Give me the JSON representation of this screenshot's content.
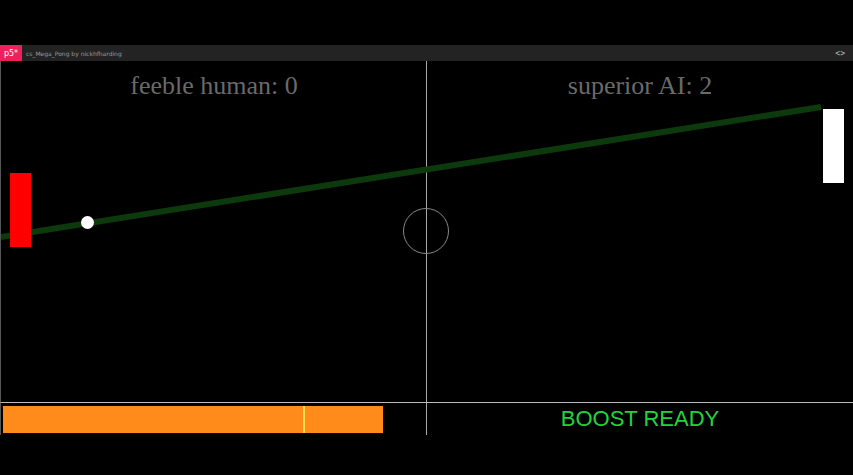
{
  "editor": {
    "logo": "p5*",
    "sketch": "cs_Mega_Pong by nickhfharding",
    "code_toggle": "<>"
  },
  "scores": [
    {
      "label": "feeble human: 0"
    },
    {
      "label": "superior AI: 2"
    }
  ],
  "paddles": [
    {
      "side": "left",
      "color": "#ff0000"
    },
    {
      "side": "right",
      "color": "#ffffff"
    }
  ],
  "boost": {
    "level": 0.9,
    "marker": 0.71,
    "status": "BOOST READY"
  }
}
